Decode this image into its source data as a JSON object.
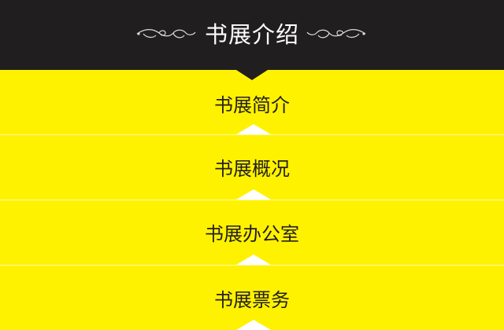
{
  "header": {
    "title": "书展介绍",
    "background": "#211e1f",
    "text_color": "#ffffff"
  },
  "menu": {
    "background": "#fff200",
    "items": [
      {
        "label": "书展简介"
      },
      {
        "label": "书展概况"
      },
      {
        "label": "书展办公室"
      },
      {
        "label": "书展票务"
      }
    ]
  }
}
